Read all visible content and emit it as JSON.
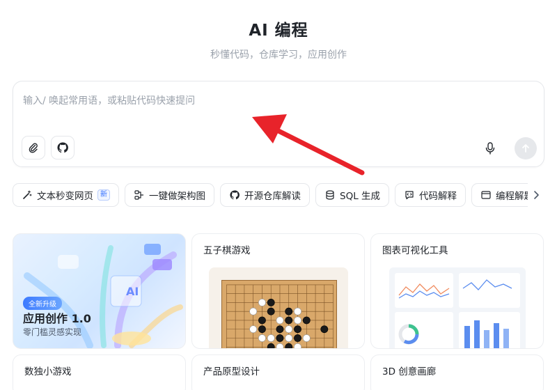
{
  "header": {
    "title": "AI 编程",
    "subtitle": "秒懂代码，仓库学习，应用创作"
  },
  "chat": {
    "placeholder": "输入/ 唤起常用语，或粘贴代码快速提问"
  },
  "chips": [
    {
      "label": "文本秒变网页",
      "icon": "magic-wand-icon",
      "badge": "新"
    },
    {
      "label": "一键做架构图",
      "icon": "diagram-icon"
    },
    {
      "label": "开源仓库解读",
      "icon": "github-icon"
    },
    {
      "label": "SQL 生成",
      "icon": "database-icon"
    },
    {
      "label": "代码解释",
      "icon": "code-comment-icon"
    },
    {
      "label": "编程解题",
      "icon": "window-icon"
    }
  ],
  "cards": {
    "promo": {
      "badge": "全新升级",
      "title": "应用创作 1.0",
      "subtitle": "零门槛灵感实现",
      "art_label": "AI"
    },
    "gomoku": {
      "title": "五子棋游戏"
    },
    "chart_tool": {
      "title": "图表可视化工具"
    },
    "sudoku": {
      "title": "数独小游戏"
    },
    "prototype": {
      "title": "产品原型设计"
    },
    "gallery": {
      "title": "3D 创意画廊"
    }
  },
  "colors": {
    "accent": "#3370ff",
    "arrow": "#e8232a",
    "board": "#d9a86a"
  }
}
